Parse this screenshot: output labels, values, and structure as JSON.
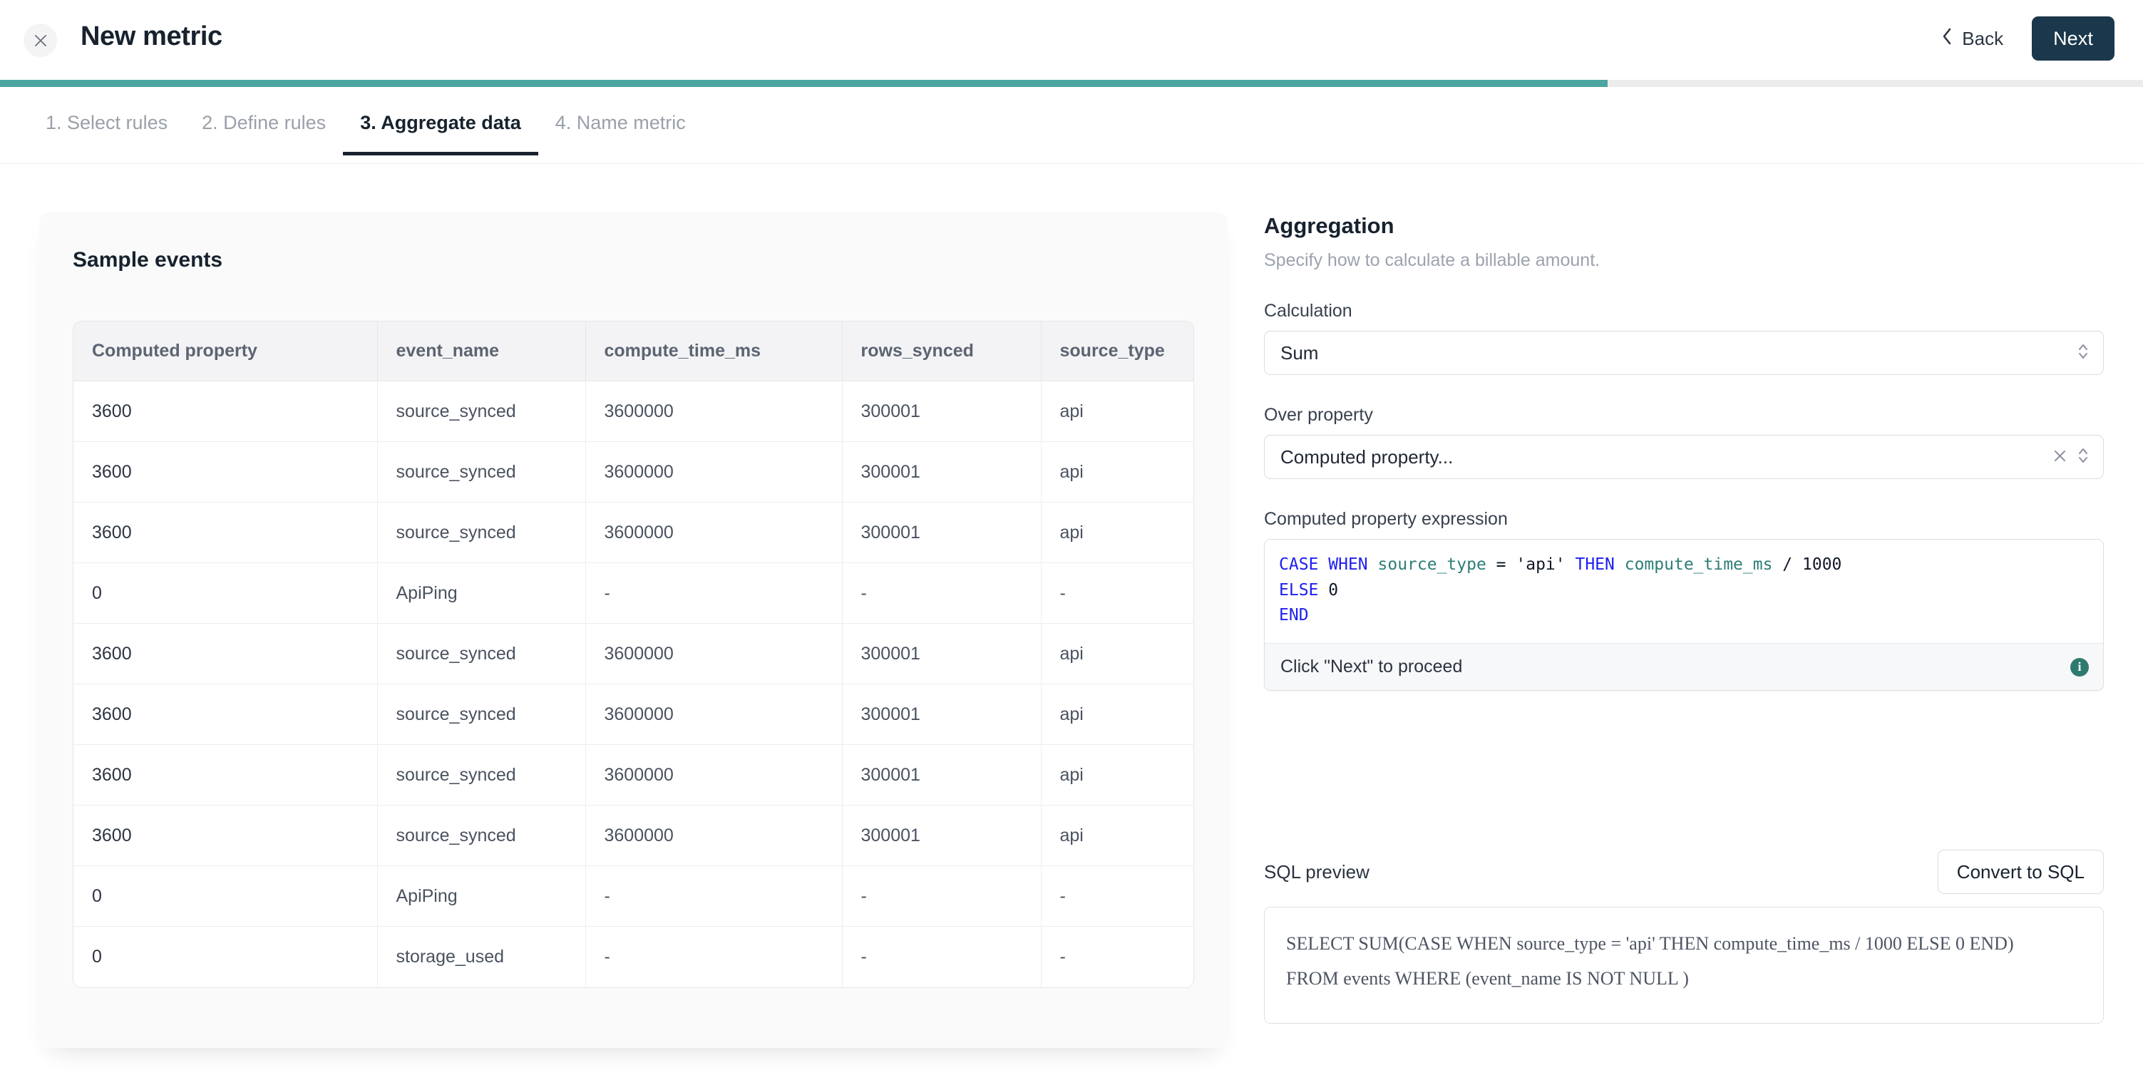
{
  "header": {
    "close_icon": "close-icon",
    "title": "New metric",
    "back_label": "Back",
    "back_icon": "chevron-left-icon",
    "next_label": "Next"
  },
  "progress": {
    "percent": 75,
    "fill_color": "#4ba5a0",
    "track_color": "#ececec"
  },
  "steps": [
    {
      "label": "1. Select rules",
      "active": false
    },
    {
      "label": "2. Define rules",
      "active": false
    },
    {
      "label": "3. Aggregate data",
      "active": true
    },
    {
      "label": "4. Name metric",
      "active": false
    }
  ],
  "sample_events": {
    "title": "Sample events",
    "columns": [
      "Computed property",
      "event_name",
      "compute_time_ms",
      "rows_synced",
      "source_type"
    ],
    "rows": [
      [
        "3600",
        "source_synced",
        "3600000",
        "300001",
        "api"
      ],
      [
        "3600",
        "source_synced",
        "3600000",
        "300001",
        "api"
      ],
      [
        "3600",
        "source_synced",
        "3600000",
        "300001",
        "api"
      ],
      [
        "0",
        "ApiPing",
        "-",
        "-",
        "-"
      ],
      [
        "3600",
        "source_synced",
        "3600000",
        "300001",
        "api"
      ],
      [
        "3600",
        "source_synced",
        "3600000",
        "300001",
        "api"
      ],
      [
        "3600",
        "source_synced",
        "3600000",
        "300001",
        "api"
      ],
      [
        "3600",
        "source_synced",
        "3600000",
        "300001",
        "api"
      ],
      [
        "0",
        "ApiPing",
        "-",
        "-",
        "-"
      ],
      [
        "0",
        "storage_used",
        "-",
        "-",
        "-"
      ]
    ]
  },
  "aggregation": {
    "title": "Aggregation",
    "subtitle": "Specify how to calculate a billable amount.",
    "calculation": {
      "label": "Calculation",
      "value": "Sum",
      "stepper_icon": "chevron-up-down-icon"
    },
    "over_property": {
      "label": "Over property",
      "value": "Computed property...",
      "clear_icon": "close-icon",
      "stepper_icon": "chevron-up-down-icon"
    },
    "expression": {
      "label": "Computed property expression",
      "tokens": [
        {
          "t": "CASE",
          "c": "kw"
        },
        {
          "t": " ",
          "c": "op"
        },
        {
          "t": "WHEN",
          "c": "kw"
        },
        {
          "t": " ",
          "c": "op"
        },
        {
          "t": "source_type",
          "c": "col"
        },
        {
          "t": " = ",
          "c": "op"
        },
        {
          "t": "'api'",
          "c": "str"
        },
        {
          "t": " ",
          "c": "op"
        },
        {
          "t": "THEN",
          "c": "kw"
        },
        {
          "t": " ",
          "c": "op"
        },
        {
          "t": "compute_time_ms",
          "c": "col"
        },
        {
          "t": " / ",
          "c": "op"
        },
        {
          "t": "1000",
          "c": "num"
        },
        {
          "t": "\n",
          "c": "op"
        },
        {
          "t": "ELSE",
          "c": "kw"
        },
        {
          "t": " ",
          "c": "op"
        },
        {
          "t": "0",
          "c": "num"
        },
        {
          "t": "\n",
          "c": "op"
        },
        {
          "t": "END",
          "c": "kw"
        }
      ],
      "plain": "CASE WHEN source_type = 'api' THEN compute_time_ms / 1000\nELSE 0\nEND",
      "footer_text": "Click \"Next\" to proceed",
      "footer_icon": "info-icon",
      "footer_icon_glyph": "i",
      "footer_icon_color": "#2f7a6f"
    }
  },
  "sql_preview": {
    "label": "SQL preview",
    "convert_button": "Convert to SQL",
    "line1": "SELECT SUM(CASE WHEN source_type = 'api' THEN compute_time_ms / 1000 ELSE 0 END)",
    "line2": "FROM events WHERE (event_name IS NOT NULL )"
  }
}
